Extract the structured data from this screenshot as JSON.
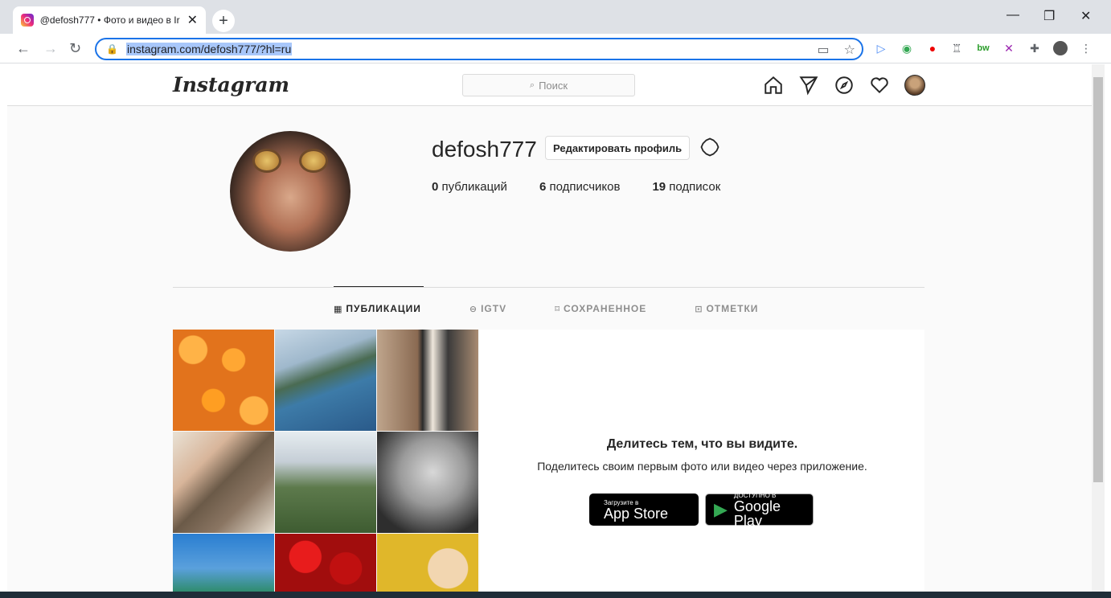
{
  "browser": {
    "tab_title": "@defosh777 • Фото и видео в Ir",
    "tab_close": "✕",
    "new_tab": "+",
    "url": "instagram.com/defosh777/?hl=ru"
  },
  "header": {
    "logo": "Instagram",
    "search_placeholder": "Поиск"
  },
  "profile": {
    "username": "defosh777",
    "edit_button": "Редактировать профиль",
    "stats": [
      {
        "count": "0",
        "label": "публикаций"
      },
      {
        "count": "6",
        "label": "подписчиков"
      },
      {
        "count": "19",
        "label": "подписок"
      }
    ]
  },
  "tabs": [
    {
      "icon": "grid-icon",
      "label": "ПУБЛИКАЦИИ"
    },
    {
      "icon": "igtv-icon",
      "label": "IGTV"
    },
    {
      "icon": "bookmark-icon",
      "label": "СОХРАНЕННОЕ"
    },
    {
      "icon": "tag-icon",
      "label": "ОТМЕТКИ"
    }
  ],
  "empty_state": {
    "title": "Делитесь тем, что вы видите.",
    "subtitle": "Поделитесь своим первым фото или видео через приложение.",
    "appstore_small": "Загрузите в",
    "appstore_big": "App Store",
    "googleplay_small": "ДОСТУПНО В",
    "googleplay_big": "Google Play"
  },
  "colors": {
    "border": "#dbdbdb",
    "text": "#262626",
    "muted": "#8e8e8e",
    "url_highlight": "#a8c7fa"
  }
}
